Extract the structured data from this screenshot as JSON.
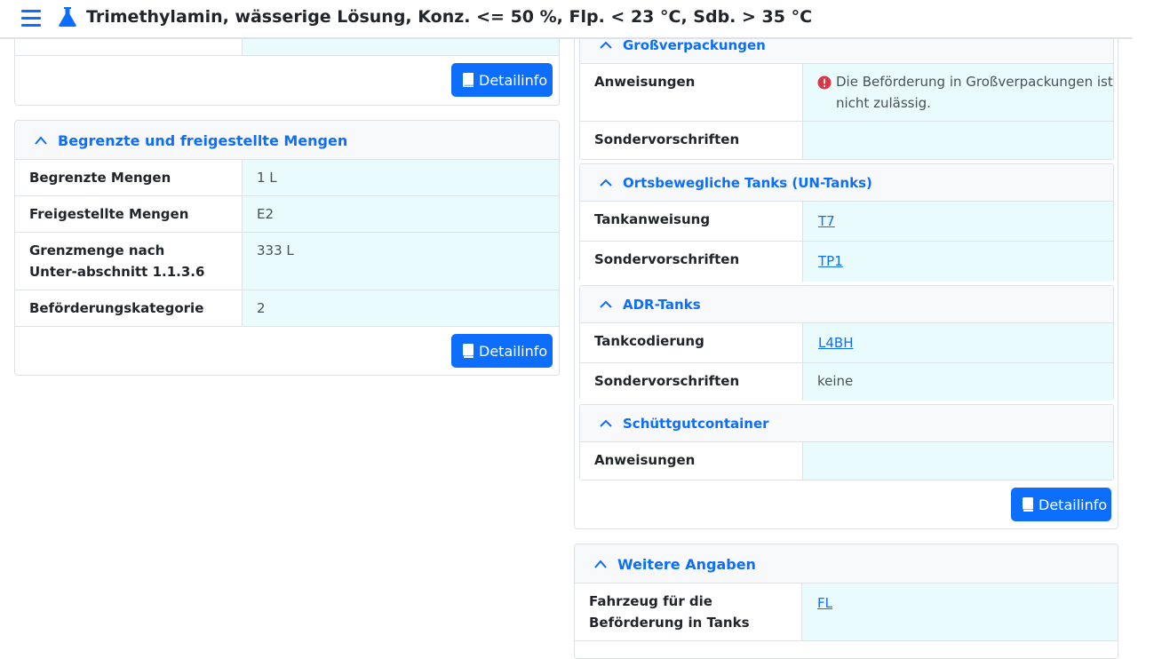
{
  "header": {
    "title": "Trimethylamin, wässerige Lösung, Konz. <= 50 %, Flp. < 23 °C, Sdb. > 35 °C"
  },
  "colors": {
    "accent": "#0d6efd",
    "value_bg": "#e9fbfd",
    "error": "#dc3545"
  },
  "icons": {
    "menu": "menu-icon",
    "flask": "flask-icon",
    "book": "book-icon",
    "chevron": "chevron-up-icon",
    "error": "exclamation-circle-icon"
  },
  "top_card": {
    "button": "Detailinfo"
  },
  "limited": {
    "heading": "Begrenzte und freigestellte Mengen",
    "rows": [
      {
        "label": "Begrenzte Mengen",
        "value": "1 L"
      },
      {
        "label": "Freigestellte Mengen",
        "value": "E2"
      },
      {
        "label": "Grenzmenge nach Unter-abschnitt 1.1.3.6",
        "value": "333 L"
      },
      {
        "label": "Beförderungskategorie",
        "value": "2"
      }
    ],
    "button": "Detailinfo"
  },
  "right": {
    "large_packaging": {
      "heading": "Großverpackungen",
      "rows": [
        {
          "label": "Anweisungen",
          "value": "Die Beförderung in Großverpackungen ist nicht zulässig."
        },
        {
          "label": "Sondervorschriften",
          "value": ""
        }
      ]
    },
    "un_tanks": {
      "heading": "Ortsbewegliche Tanks (UN-Tanks)",
      "rows": [
        {
          "label": "Tankanweisung",
          "value": "T7"
        },
        {
          "label": "Sondervorschriften",
          "value": "TP1"
        }
      ]
    },
    "adr_tanks": {
      "heading": "ADR-Tanks",
      "rows": [
        {
          "label": "Tankcodierung",
          "value": "L4BH"
        },
        {
          "label": "Sondervorschriften",
          "value": "keine"
        }
      ]
    },
    "bulk": {
      "heading": "Schüttgutcontainer",
      "rows": [
        {
          "label": "Anweisungen",
          "value": ""
        }
      ]
    },
    "button": "Detailinfo"
  },
  "further": {
    "heading": "Weitere Angaben",
    "rows": [
      {
        "label": "Fahrzeug für die Beförderung in Tanks",
        "value": "FL"
      }
    ]
  }
}
